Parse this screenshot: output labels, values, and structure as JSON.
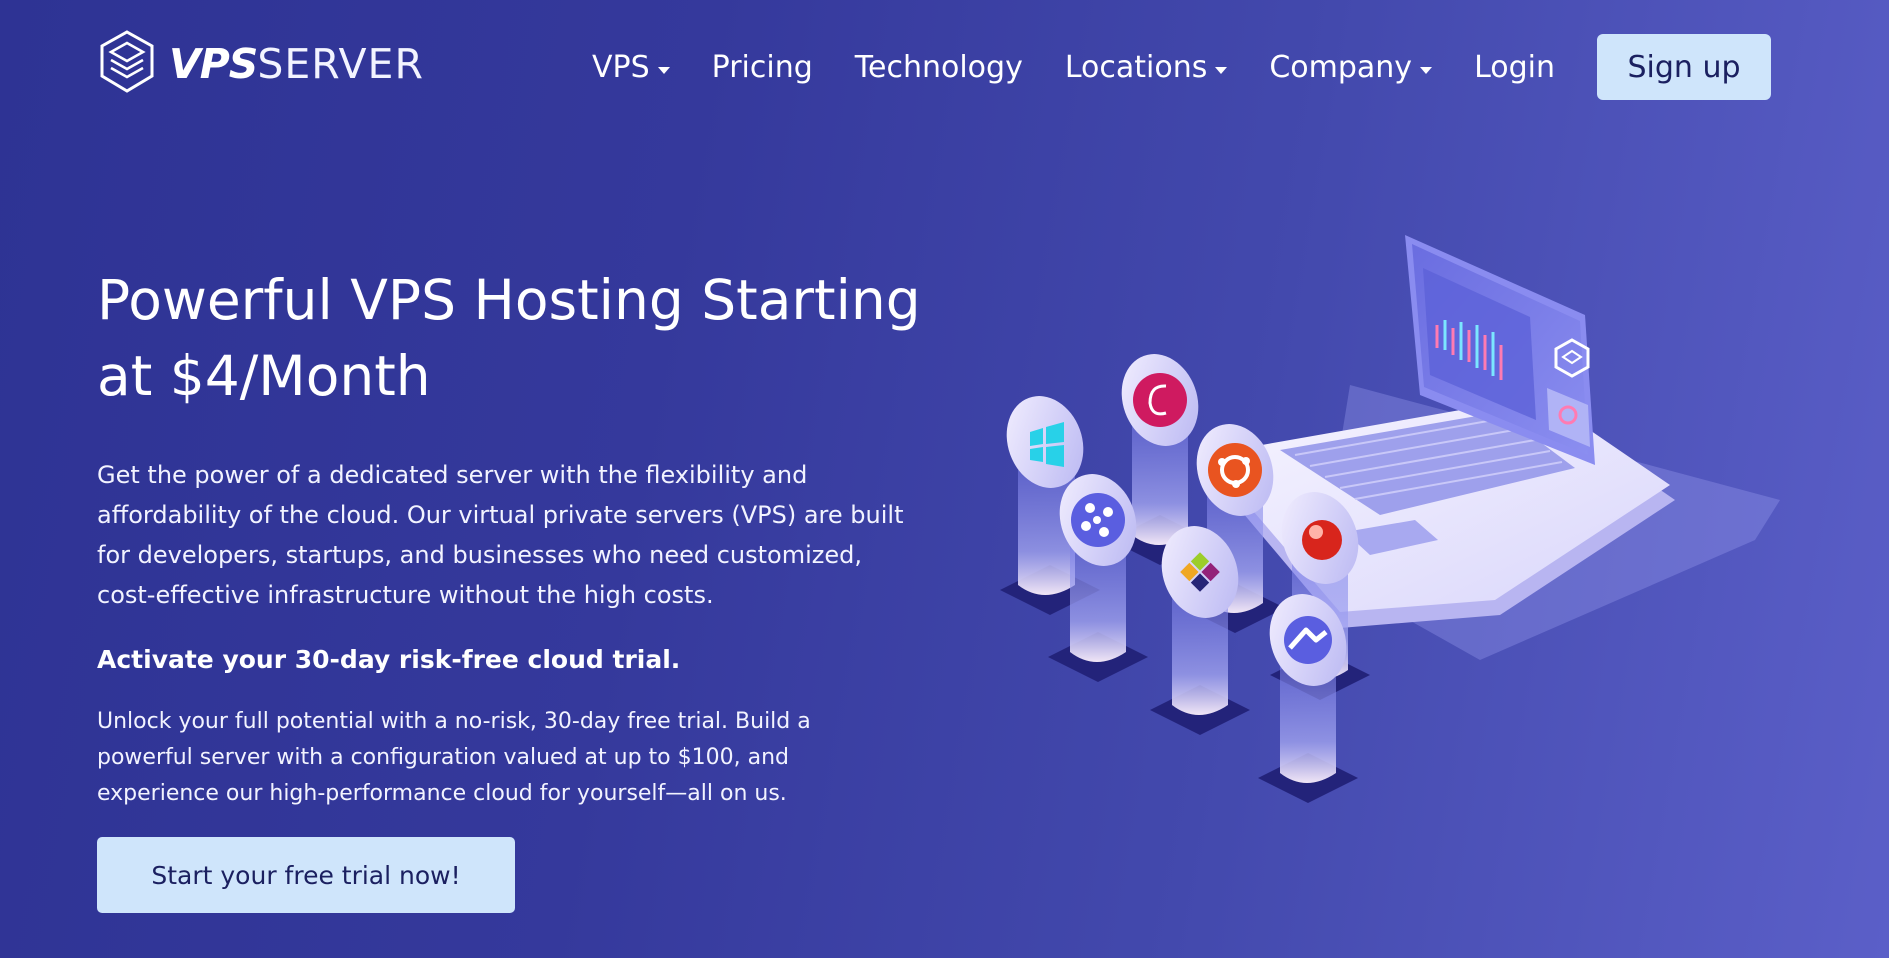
{
  "brand": {
    "logo_bold": "VPS",
    "logo_thin": "SERVER"
  },
  "nav": {
    "items": [
      {
        "label": "VPS",
        "has_dropdown": true
      },
      {
        "label": "Pricing",
        "has_dropdown": false
      },
      {
        "label": "Technology",
        "has_dropdown": false
      },
      {
        "label": "Locations",
        "has_dropdown": true
      },
      {
        "label": "Company",
        "has_dropdown": true
      },
      {
        "label": "Login",
        "has_dropdown": false
      }
    ],
    "signup_label": "Sign up"
  },
  "hero": {
    "title": "Powerful VPS Hosting Starting at $4/Month",
    "description": "Get the power of a dedicated server with the flexibility and affordability of the cloud. Our virtual private servers (VPS) are built for developers, startups, and businesses who need customized, cost-effective infrastructure without the high costs.",
    "trial_heading": "Activate your 30-day risk-free cloud trial.",
    "trial_description": "Unlock your full potential with a no-risk, 30-day free trial. Build a powerful server with a configuration valued at up to $100, and experience our high-performance cloud for yourself—all on us.",
    "cta_label": "Start your free trial now!"
  },
  "illustration": {
    "device": "laptop-icon",
    "os_icons": [
      "windows-icon",
      "debian-icon",
      "almalinux-icon",
      "ubuntu-icon",
      "centos-icon",
      "fedora-icon",
      "rocky-linux-icon"
    ]
  },
  "colors": {
    "background_start": "#2e3394",
    "background_end": "#5b5fc8",
    "button_bg": "#cfe5fb",
    "button_text": "#1b2060",
    "text": "#ffffff"
  }
}
